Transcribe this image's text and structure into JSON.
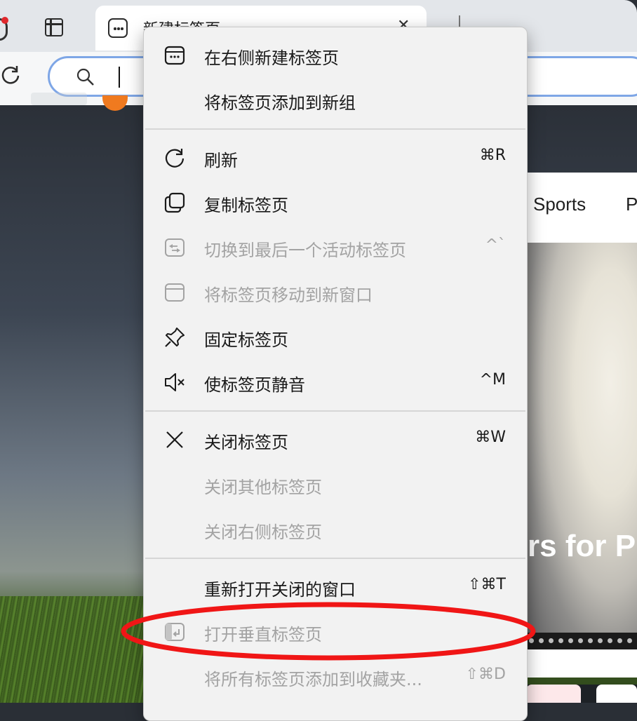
{
  "tab": {
    "title": "新建标签页",
    "close_glyph": "✕"
  },
  "news": {
    "tab_sports": "Sports",
    "tab_partial": "P",
    "headline_partial": "rs for P"
  },
  "menu": {
    "items": [
      {
        "label": "在右侧新建标签页",
        "shortcut": "",
        "icon": "new-tab-right-icon",
        "enabled": true
      },
      {
        "label": "将标签页添加到新组",
        "shortcut": "",
        "icon": "",
        "enabled": true
      },
      {
        "label": "刷新",
        "shortcut": "⌘R",
        "icon": "refresh-icon",
        "enabled": true
      },
      {
        "label": "复制标签页",
        "shortcut": "",
        "icon": "duplicate-icon",
        "enabled": true
      },
      {
        "label": "切换到最后一个活动标签页",
        "shortcut": "^`",
        "icon": "switch-tab-icon",
        "enabled": false
      },
      {
        "label": "将标签页移动到新窗口",
        "shortcut": "",
        "icon": "window-icon",
        "enabled": false
      },
      {
        "label": "固定标签页",
        "shortcut": "",
        "icon": "pin-icon",
        "enabled": true
      },
      {
        "label": "使标签页静音",
        "shortcut": "^M",
        "icon": "mute-icon",
        "enabled": true
      },
      {
        "label": "关闭标签页",
        "shortcut": "⌘W",
        "icon": "close-icon",
        "enabled": true
      },
      {
        "label": "关闭其他标签页",
        "shortcut": "",
        "icon": "",
        "enabled": false
      },
      {
        "label": "关闭右侧标签页",
        "shortcut": "",
        "icon": "",
        "enabled": false
      },
      {
        "label": "重新打开关闭的窗口",
        "shortcut": "⇧⌘T",
        "icon": "",
        "enabled": true
      },
      {
        "label": "打开垂直标签页",
        "shortcut": "",
        "icon": "vertical-tabs-icon",
        "enabled": false
      },
      {
        "label": "将所有标签页添加到收藏夹...",
        "shortcut": "⇧⌘D",
        "icon": "",
        "enabled": false
      }
    ]
  },
  "annotation": {
    "color": "#f01616",
    "target": "打开垂直标签页"
  }
}
